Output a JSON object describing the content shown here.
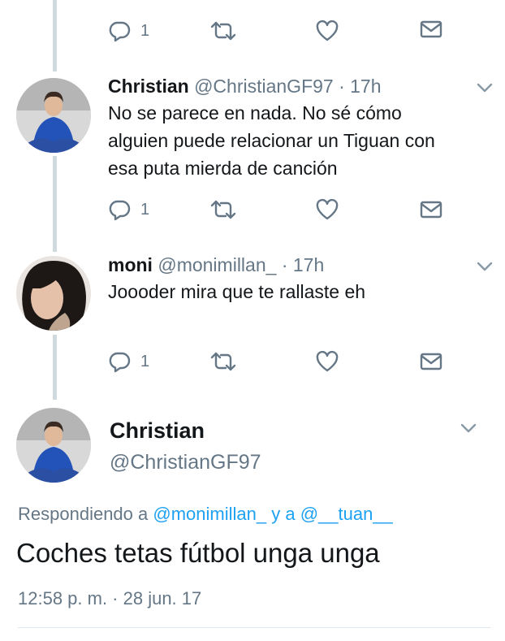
{
  "tweets": [
    {
      "name": "Christian",
      "handle": "@ChristianGF97",
      "time": "· 17h",
      "text_lines": [
        "No se parece en nada. No sé cómo",
        "alguien puede relacionar un Tiguan con",
        "esa puta mierda de canción"
      ],
      "reply_count": "1"
    },
    {
      "name": "moni",
      "handle": "@monimillan_",
      "time": "· 17h",
      "text_lines": [
        "Joooder mira que te rallaste eh"
      ],
      "reply_count": "1"
    }
  ],
  "top_partial": {
    "reply_count": "1"
  },
  "main_tweet": {
    "name": "Christian",
    "handle": "@ChristianGF97",
    "replying_prefix": "Respondiendo a",
    "replying_user1": "@monimillan_",
    "replying_mid": "y a",
    "replying_user2": "@__tuan__",
    "text": "Coches tetas fútbol unga unga",
    "timestamp": "12:58 p. m. · 28 jun. 17"
  },
  "colors": {
    "link": "#1da1f2",
    "muted": "#657786",
    "thread": "#cfd9de"
  }
}
